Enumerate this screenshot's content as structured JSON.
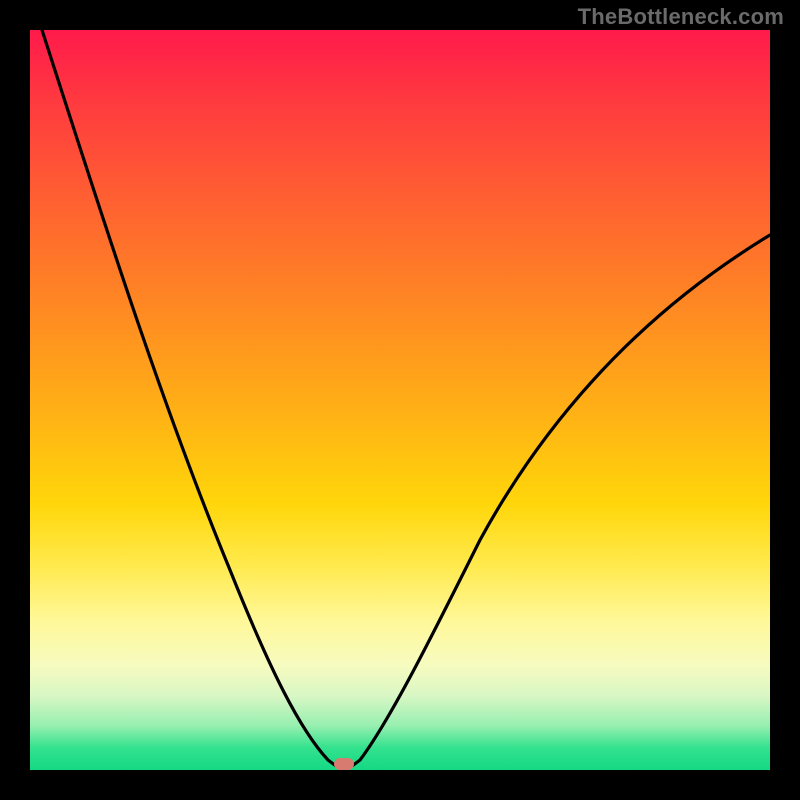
{
  "watermark": "TheBottleneck.com",
  "chart_data": {
    "type": "line",
    "title": "",
    "xlabel": "",
    "ylabel": "",
    "xlim": [
      0,
      100
    ],
    "ylim": [
      0,
      100
    ],
    "grid": false,
    "background": "rainbow-gradient (red top to green bottom)",
    "series": [
      {
        "name": "bottleneck-curve",
        "x": [
          0,
          4,
          8,
          12,
          16,
          20,
          24,
          28,
          32,
          36,
          38,
          40,
          42,
          44,
          46,
          50,
          54,
          58,
          62,
          66,
          70,
          74,
          78,
          82,
          86,
          90,
          94,
          98,
          100
        ],
        "y": [
          100,
          92,
          83,
          74,
          65,
          56,
          47,
          38,
          29,
          17,
          10,
          4,
          0,
          0,
          4,
          14,
          24,
          33,
          41,
          48,
          54,
          59,
          63,
          66,
          68,
          70,
          71,
          72,
          72
        ]
      }
    ],
    "annotations": [
      {
        "name": "optimal-marker",
        "x": 42,
        "y": 0,
        "shape": "rounded-rect",
        "color": "#d77a6f"
      }
    ]
  },
  "colors": {
    "border": "#000000",
    "curve": "#000000",
    "marker": "#d77a6f",
    "watermark": "#6a6a6a"
  }
}
